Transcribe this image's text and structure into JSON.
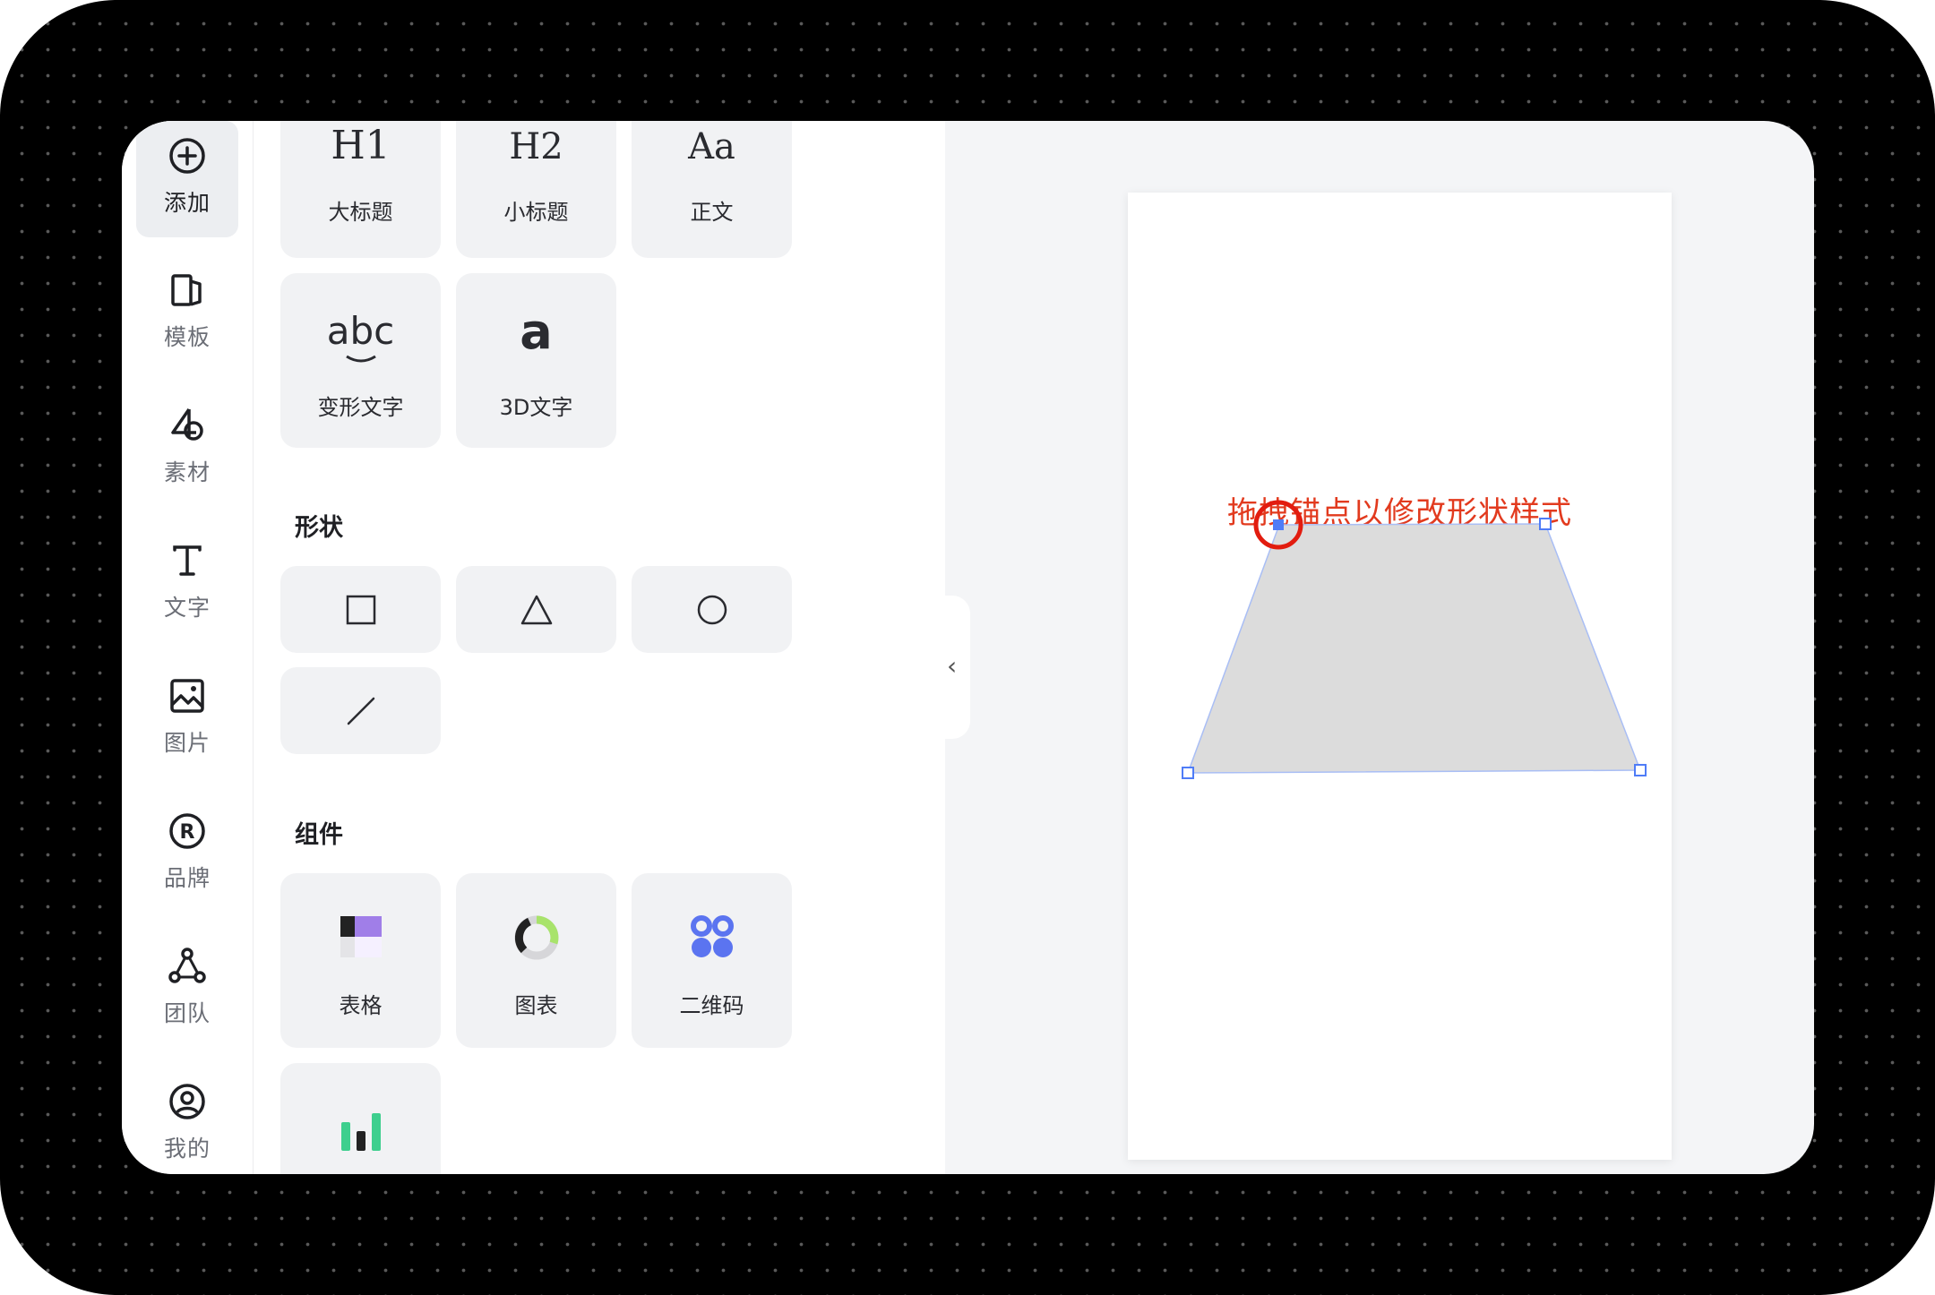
{
  "nav": {
    "items": [
      {
        "label": "添加",
        "icon": "add-circle-icon",
        "active": true
      },
      {
        "label": "模板",
        "icon": "template-icon"
      },
      {
        "label": "素材",
        "icon": "material-icon"
      },
      {
        "label": "文字",
        "icon": "text-icon"
      },
      {
        "label": "图片",
        "icon": "image-icon"
      },
      {
        "label": "品牌",
        "icon": "brand-icon"
      },
      {
        "label": "团队",
        "icon": "team-icon"
      },
      {
        "label": "我的",
        "icon": "user-icon"
      }
    ]
  },
  "text_tiles": [
    {
      "glyph": "H1",
      "label": "大标题"
    },
    {
      "glyph": "H2",
      "label": "小标题"
    },
    {
      "glyph": "Aa",
      "label": "正文"
    },
    {
      "glyph": "abc",
      "label": "变形文字"
    },
    {
      "glyph": "a",
      "label": "3D文字"
    }
  ],
  "shapes_section": {
    "title": "形状"
  },
  "components_section": {
    "title": "组件",
    "items": [
      {
        "label": "表格",
        "icon": "table-icon"
      },
      {
        "label": "图表",
        "icon": "chart-icon"
      },
      {
        "label": "二维码",
        "icon": "qrcode-icon"
      },
      {
        "label": "",
        "icon": "bar-chart-icon"
      }
    ]
  },
  "canvas": {
    "hint": "拖拽锚点以修改形状样式"
  },
  "colors": {
    "accent_blue": "#4f7cf7",
    "hint_red": "#e23a1e",
    "shape_fill": "#dcdcdc"
  }
}
